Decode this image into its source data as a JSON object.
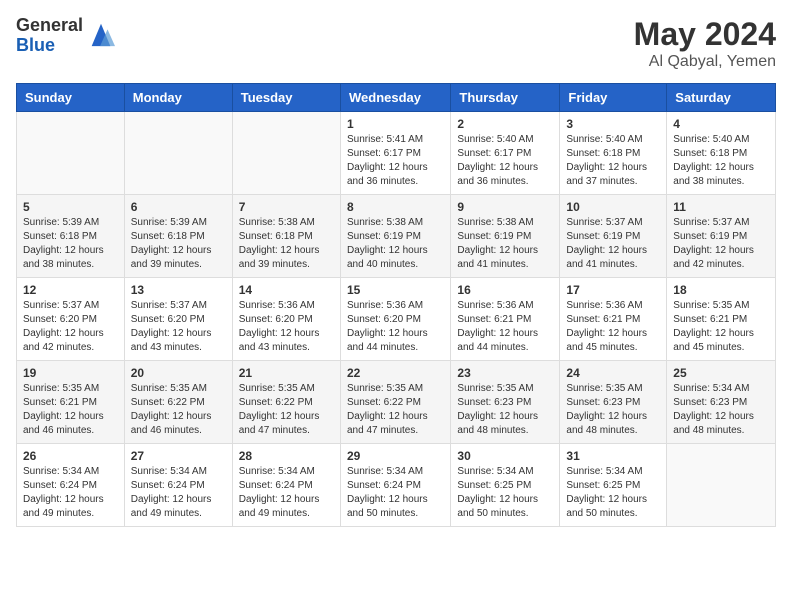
{
  "logo": {
    "general": "General",
    "blue": "Blue"
  },
  "title": {
    "month_year": "May 2024",
    "location": "Al Qabyal, Yemen"
  },
  "headers": [
    "Sunday",
    "Monday",
    "Tuesday",
    "Wednesday",
    "Thursday",
    "Friday",
    "Saturday"
  ],
  "weeks": [
    [
      {
        "day": "",
        "info": ""
      },
      {
        "day": "",
        "info": ""
      },
      {
        "day": "",
        "info": ""
      },
      {
        "day": "1",
        "info": "Sunrise: 5:41 AM\nSunset: 6:17 PM\nDaylight: 12 hours\nand 36 minutes."
      },
      {
        "day": "2",
        "info": "Sunrise: 5:40 AM\nSunset: 6:17 PM\nDaylight: 12 hours\nand 36 minutes."
      },
      {
        "day": "3",
        "info": "Sunrise: 5:40 AM\nSunset: 6:18 PM\nDaylight: 12 hours\nand 37 minutes."
      },
      {
        "day": "4",
        "info": "Sunrise: 5:40 AM\nSunset: 6:18 PM\nDaylight: 12 hours\nand 38 minutes."
      }
    ],
    [
      {
        "day": "5",
        "info": "Sunrise: 5:39 AM\nSunset: 6:18 PM\nDaylight: 12 hours\nand 38 minutes."
      },
      {
        "day": "6",
        "info": "Sunrise: 5:39 AM\nSunset: 6:18 PM\nDaylight: 12 hours\nand 39 minutes."
      },
      {
        "day": "7",
        "info": "Sunrise: 5:38 AM\nSunset: 6:18 PM\nDaylight: 12 hours\nand 39 minutes."
      },
      {
        "day": "8",
        "info": "Sunrise: 5:38 AM\nSunset: 6:19 PM\nDaylight: 12 hours\nand 40 minutes."
      },
      {
        "day": "9",
        "info": "Sunrise: 5:38 AM\nSunset: 6:19 PM\nDaylight: 12 hours\nand 41 minutes."
      },
      {
        "day": "10",
        "info": "Sunrise: 5:37 AM\nSunset: 6:19 PM\nDaylight: 12 hours\nand 41 minutes."
      },
      {
        "day": "11",
        "info": "Sunrise: 5:37 AM\nSunset: 6:19 PM\nDaylight: 12 hours\nand 42 minutes."
      }
    ],
    [
      {
        "day": "12",
        "info": "Sunrise: 5:37 AM\nSunset: 6:20 PM\nDaylight: 12 hours\nand 42 minutes."
      },
      {
        "day": "13",
        "info": "Sunrise: 5:37 AM\nSunset: 6:20 PM\nDaylight: 12 hours\nand 43 minutes."
      },
      {
        "day": "14",
        "info": "Sunrise: 5:36 AM\nSunset: 6:20 PM\nDaylight: 12 hours\nand 43 minutes."
      },
      {
        "day": "15",
        "info": "Sunrise: 5:36 AM\nSunset: 6:20 PM\nDaylight: 12 hours\nand 44 minutes."
      },
      {
        "day": "16",
        "info": "Sunrise: 5:36 AM\nSunset: 6:21 PM\nDaylight: 12 hours\nand 44 minutes."
      },
      {
        "day": "17",
        "info": "Sunrise: 5:36 AM\nSunset: 6:21 PM\nDaylight: 12 hours\nand 45 minutes."
      },
      {
        "day": "18",
        "info": "Sunrise: 5:35 AM\nSunset: 6:21 PM\nDaylight: 12 hours\nand 45 minutes."
      }
    ],
    [
      {
        "day": "19",
        "info": "Sunrise: 5:35 AM\nSunset: 6:21 PM\nDaylight: 12 hours\nand 46 minutes."
      },
      {
        "day": "20",
        "info": "Sunrise: 5:35 AM\nSunset: 6:22 PM\nDaylight: 12 hours\nand 46 minutes."
      },
      {
        "day": "21",
        "info": "Sunrise: 5:35 AM\nSunset: 6:22 PM\nDaylight: 12 hours\nand 47 minutes."
      },
      {
        "day": "22",
        "info": "Sunrise: 5:35 AM\nSunset: 6:22 PM\nDaylight: 12 hours\nand 47 minutes."
      },
      {
        "day": "23",
        "info": "Sunrise: 5:35 AM\nSunset: 6:23 PM\nDaylight: 12 hours\nand 48 minutes."
      },
      {
        "day": "24",
        "info": "Sunrise: 5:35 AM\nSunset: 6:23 PM\nDaylight: 12 hours\nand 48 minutes."
      },
      {
        "day": "25",
        "info": "Sunrise: 5:34 AM\nSunset: 6:23 PM\nDaylight: 12 hours\nand 48 minutes."
      }
    ],
    [
      {
        "day": "26",
        "info": "Sunrise: 5:34 AM\nSunset: 6:24 PM\nDaylight: 12 hours\nand 49 minutes."
      },
      {
        "day": "27",
        "info": "Sunrise: 5:34 AM\nSunset: 6:24 PM\nDaylight: 12 hours\nand 49 minutes."
      },
      {
        "day": "28",
        "info": "Sunrise: 5:34 AM\nSunset: 6:24 PM\nDaylight: 12 hours\nand 49 minutes."
      },
      {
        "day": "29",
        "info": "Sunrise: 5:34 AM\nSunset: 6:24 PM\nDaylight: 12 hours\nand 50 minutes."
      },
      {
        "day": "30",
        "info": "Sunrise: 5:34 AM\nSunset: 6:25 PM\nDaylight: 12 hours\nand 50 minutes."
      },
      {
        "day": "31",
        "info": "Sunrise: 5:34 AM\nSunset: 6:25 PM\nDaylight: 12 hours\nand 50 minutes."
      },
      {
        "day": "",
        "info": ""
      }
    ]
  ]
}
